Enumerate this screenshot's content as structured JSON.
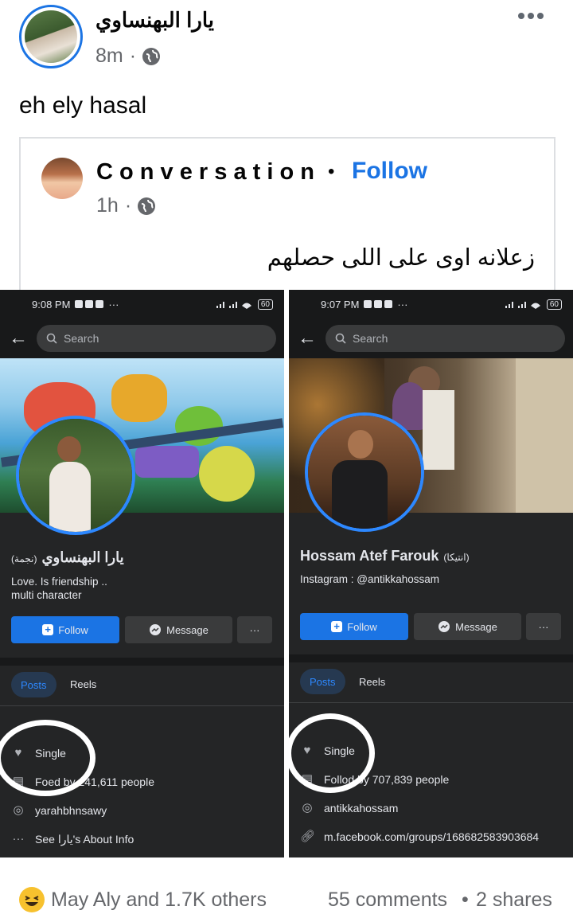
{
  "post": {
    "author": "يارا البهنساوي",
    "time": "8m",
    "privacy_icon": "globe-icon",
    "menu_icon": "more-horizontal-icon",
    "text": "eh ely hasal"
  },
  "shared": {
    "author": "C o n v e r s a t i o n",
    "separator": "•",
    "follow_label": "Follow",
    "time": "1h",
    "privacy_icon": "globe-icon",
    "text": "زعلانه اوى على اللى حصلهم"
  },
  "left_screen": {
    "status_time": "9:08 PM",
    "status_dots": "···",
    "battery": "60",
    "search_placeholder": "Search",
    "name": "يارا البهنساوي",
    "nickname": "(نجمة)",
    "bio_line1": "Love. Is friendship ..",
    "bio_line2": "multi character",
    "follow_label": "Follow",
    "message_label": "Message",
    "more_label": "···",
    "tabs": [
      "Posts",
      "Reels"
    ],
    "relationship": "Single",
    "followers_prefix": "Fo",
    "followers_suffix": "ed by 241,611 people",
    "instagram": "yarahbhnsawy",
    "about": "See يارا's About Info",
    "colors": {
      "accent": "#1b74e4"
    }
  },
  "right_screen": {
    "status_time": "9:07 PM",
    "status_dots": "···",
    "battery": "60",
    "search_placeholder": "Search",
    "name": "Hossam Atef Farouk",
    "nickname": "(انتيكا)",
    "bio_line1": "Instagram : @antikkahossam",
    "follow_label": "Follow",
    "message_label": "Message",
    "more_label": "···",
    "tabs": [
      "Posts",
      "Reels"
    ],
    "relationship": "Single",
    "followers_prefix": "Follo",
    "followers_suffix": "d by 707,839 people",
    "instagram": "antikkahossam",
    "link": "m.facebook.com/groups/168682583903684"
  },
  "footer": {
    "reaction_icon": "haha-reaction-icon",
    "reactions": "May Aly and 1.7K others",
    "comments": "55 comments",
    "dot": "•",
    "shares": "2 shares"
  }
}
